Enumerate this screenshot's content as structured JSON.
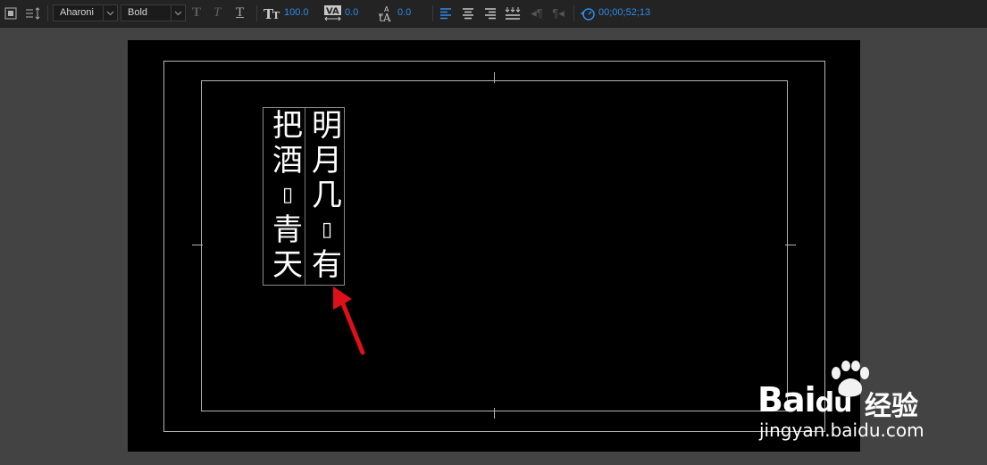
{
  "toolbar": {
    "font_family": "Aharoni",
    "font_style": "Bold",
    "font_size": "100.0",
    "tracking": "0.0",
    "baseline_shift": "0.0",
    "timecode": "00;00;52;13"
  },
  "canvas": {
    "columns": [
      [
        "把",
        "酒",
        "▯",
        "青",
        "天"
      ],
      [
        "明",
        "月",
        "几",
        "▯",
        "有"
      ]
    ]
  },
  "watermark": {
    "brand": "Bai",
    "brand_tail": "du",
    "suffix": "经验",
    "url": "jingyan.baidu.com"
  },
  "colors": {
    "accent": "#2d8ceb",
    "arrow": "#e0101a",
    "stage": "#000000",
    "panel": "#434343"
  }
}
